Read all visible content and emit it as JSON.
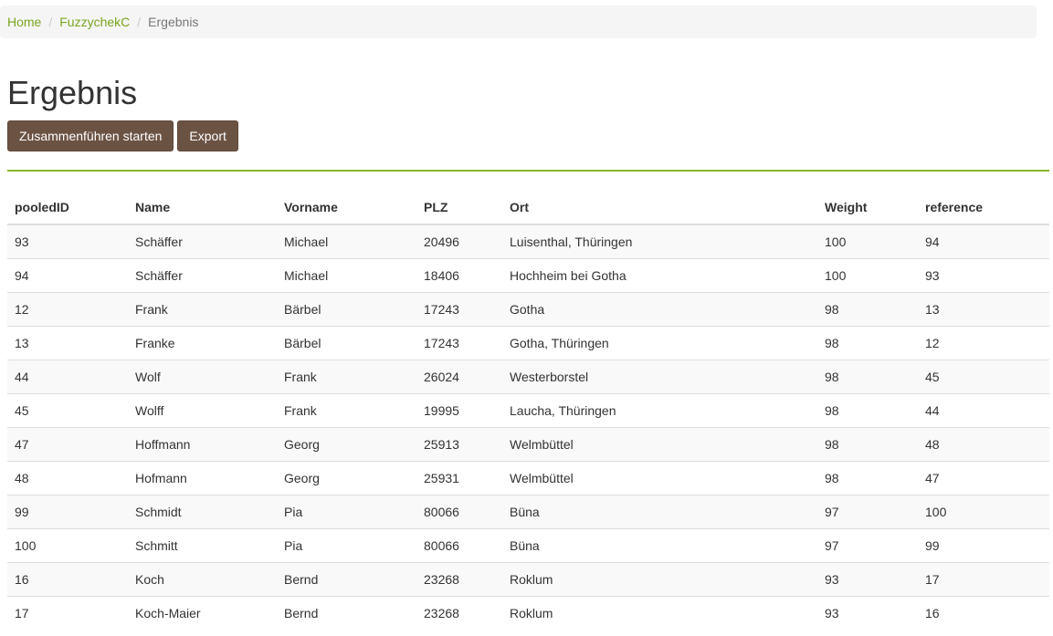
{
  "breadcrumb": {
    "home": "Home",
    "section": "FuzzychekC",
    "current": "Ergebnis",
    "separator": "/"
  },
  "page": {
    "title": "Ergebnis"
  },
  "toolbar": {
    "merge_label": "Zusammenführen starten",
    "export_label": "Export"
  },
  "table": {
    "headers": [
      "pooledID",
      "Name",
      "Vorname",
      "PLZ",
      "Ort",
      "Weight",
      "reference"
    ],
    "rows": [
      [
        "93",
        "Schäffer",
        "Michael",
        "20496",
        "Luisenthal, Thüringen",
        "100",
        "94"
      ],
      [
        "94",
        "Schäffer",
        "Michael",
        "18406",
        "Hochheim bei Gotha",
        "100",
        "93"
      ],
      [
        "12",
        "Frank",
        "Bärbel",
        "17243",
        "Gotha",
        "98",
        "13"
      ],
      [
        "13",
        "Franke",
        "Bärbel",
        "17243",
        "Gotha, Thüringen",
        "98",
        "12"
      ],
      [
        "44",
        "Wolf",
        "Frank",
        "26024",
        "Westerborstel",
        "98",
        "45"
      ],
      [
        "45",
        "Wolff",
        "Frank",
        "19995",
        "Laucha, Thüringen",
        "98",
        "44"
      ],
      [
        "47",
        "Hoffmann",
        "Georg",
        "25913",
        "Welmbüttel",
        "98",
        "48"
      ],
      [
        "48",
        "Hofmann",
        "Georg",
        "25931",
        "Welmbüttel",
        "98",
        "47"
      ],
      [
        "99",
        "Schmidt",
        "Pia",
        "80066",
        "Büna",
        "97",
        "100"
      ],
      [
        "100",
        "Schmitt",
        "Pia",
        "80066",
        "Büna",
        "97",
        "99"
      ],
      [
        "16",
        "Koch",
        "Bernd",
        "23268",
        "Roklum",
        "93",
        "17"
      ],
      [
        "17",
        "Koch-Maier",
        "Bernd",
        "23268",
        "Roklum",
        "93",
        "16"
      ]
    ]
  },
  "colors": {
    "accent_green": "#8ab52c",
    "link_green": "#7aa520",
    "button_brown": "#6b5344"
  }
}
